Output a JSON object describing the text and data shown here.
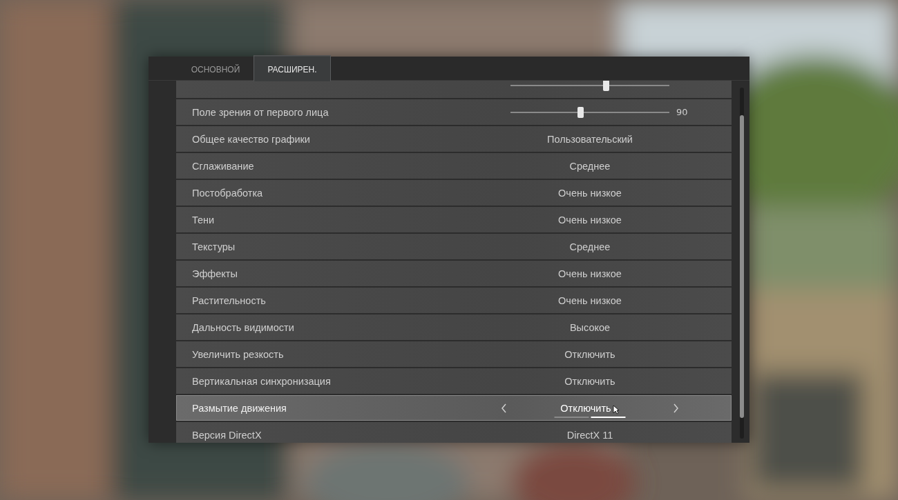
{
  "tabs": [
    {
      "label": "ОСНОВНОЙ",
      "selected": false
    },
    {
      "label": "РАСШИРЕН.",
      "selected": true
    }
  ],
  "settings": [
    {
      "kind": "slider",
      "selected": false,
      "level": 0.6
    },
    {
      "kind": "slider",
      "label": "Поле зрения от первого лица",
      "selected": false,
      "level": 0.44,
      "reading": "90"
    },
    {
      "kind": "option",
      "label": "Общее качество графики",
      "selected": false,
      "value": "Пользовательский"
    },
    {
      "kind": "option",
      "label": "Сглаживание",
      "selected": false,
      "value": "Среднее"
    },
    {
      "kind": "option",
      "label": "Постобработка",
      "selected": false,
      "value": "Очень низкое"
    },
    {
      "kind": "option",
      "label": "Тени",
      "selected": false,
      "value": "Очень низкое"
    },
    {
      "kind": "option",
      "label": "Текстуры",
      "selected": false,
      "value": "Среднее"
    },
    {
      "kind": "option",
      "label": "Эффекты",
      "selected": false,
      "value": "Очень низкое"
    },
    {
      "kind": "option",
      "label": "Растительность",
      "selected": false,
      "value": "Очень низкое"
    },
    {
      "kind": "option",
      "label": "Дальность видимости",
      "selected": false,
      "value": "Высокое"
    },
    {
      "kind": "option",
      "label": "Увеличить резкость",
      "selected": false,
      "value": "Отключить"
    },
    {
      "kind": "option",
      "label": "Вертикальная синхронизация",
      "selected": false,
      "value": "Отключить"
    },
    {
      "kind": "option",
      "label": "Размытие движения",
      "selected": true,
      "value": "Отключить",
      "segments": [
        {
          "selected": false
        },
        {
          "selected": true
        }
      ]
    },
    {
      "kind": "option",
      "label": "Версия DirectX",
      "selected": false,
      "value": "DirectX 11"
    }
  ]
}
